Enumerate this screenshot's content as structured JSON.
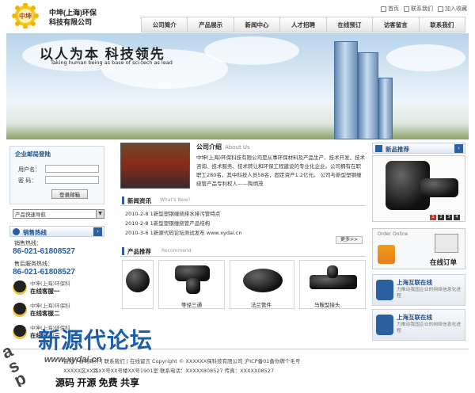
{
  "header": {
    "logo_text": "中坤",
    "company_line1": "中坤(上海)环保",
    "company_line2": "科技有限公司",
    "top_links": [
      "首页",
      "联系我们",
      "加入收藏"
    ],
    "nav": [
      "公司简介",
      "产品展示",
      "新闻中心",
      "人才招聘",
      "在线预订",
      "访客留言",
      "联系我们"
    ]
  },
  "banner": {
    "slogan": "以人为本  科技领先",
    "slogan_en": "Taking human being as base of sci-tech as lead"
  },
  "login": {
    "title": "企业邮局登陆",
    "user_label": "用户名：",
    "pass_label": "密  码：",
    "button": "登录邮箱"
  },
  "select": {
    "value": "产品快速导航"
  },
  "hotline": {
    "title": "销售热线",
    "sales_label": "销售热线：",
    "sales_phone": "86-021-61808527",
    "service_label": "售后服务热线：",
    "service_phone": "86-021-61808527",
    "qq": [
      {
        "name": "中坤(上海)环保科",
        "status": "在线客服一"
      },
      {
        "name": "中坤(上海)环保科",
        "status": "在线客服二"
      },
      {
        "name": "中坤(上海)环保科",
        "status": "在线客服三"
      }
    ]
  },
  "about": {
    "title": "公司介绍",
    "title_en": "About Us",
    "text": "中坤(上海)环保科技有限公司是从事环保材料及产品生产、技术开发、技术咨询、技术服务、技术转让和环保工程建设的专业化企业。公司拥有在职职工280名，其中科技人员58名，固定资产1.2亿元。  公司与新型塑钢缠绕管产品专利权人——陶炳茂"
  },
  "news": {
    "title": "新闻资讯",
    "title_en": "What's New?",
    "items": [
      "2010-2-8  1新型塑钢缠绕排水排污管特点",
      "2010-2-8  1新型塑钢缠绕管产品结构",
      "2010-3-6  1新源代码论坛测试发布 www.xydai.cn"
    ],
    "more": "更多>>"
  },
  "products": {
    "title": "产品推荐",
    "title_en": "Recommend",
    "items": [
      "",
      "等径三通",
      "法兰管件",
      "马鞍型接头"
    ]
  },
  "new_products": {
    "title": "新品推荐",
    "pages": [
      "1",
      "2",
      "3",
      "4"
    ]
  },
  "order": {
    "label_en": "Order Online",
    "label": "在线订单"
  },
  "services": [
    {
      "title": "上海互联在线",
      "desc": "力推动我国企业的网络信息化进程"
    },
    {
      "title": "上海互联在线",
      "desc": "力推动我国企业的网络信息化进程"
    }
  ],
  "footer": {
    "line1": "首页 | 公司简介 | 联系我们 | 在线留言   Copyright © XXXXXX保科技有限公司 沪ICP备01备你牌个毛号",
    "line2": "XXXXX区XX路XX号XX号楼XX号1901室 联系电话：XXXXX808527 传真：XXXXX08527"
  },
  "watermark": {
    "title": "新源代论坛",
    "url": "www.xydai.cn",
    "tagline": "源码 开源 免费 共享",
    "side": "asp"
  }
}
